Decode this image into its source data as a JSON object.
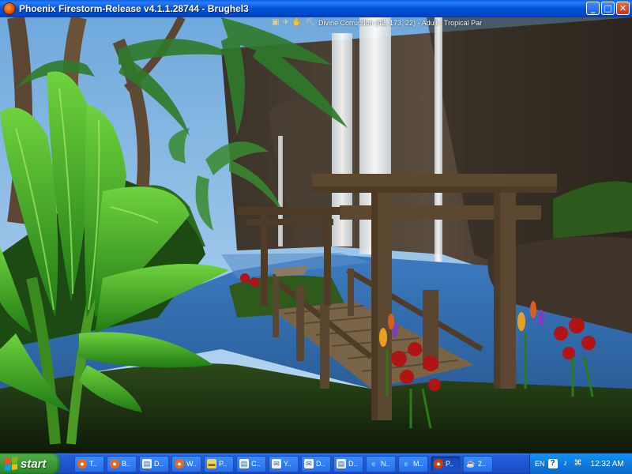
{
  "window": {
    "title": "Phoenix Firestorm-Release v4.1.1.28744 - Brughel3",
    "controls": {
      "minimize": "_",
      "maximize": "□",
      "close": "✕"
    }
  },
  "hud": {
    "icons": [
      "inventory-icon",
      "no-fly-icon",
      "no-push-icon",
      "no-build-icon"
    ],
    "location": "Divine Corruption (42, 173, 22) - Adult - Tropical Par"
  },
  "taskbar": {
    "start_label": "start",
    "tasks": [
      {
        "label": "T..",
        "icon": "firefox-icon"
      },
      {
        "label": "B..",
        "icon": "firefox-icon"
      },
      {
        "label": "D..",
        "icon": "document-icon"
      },
      {
        "label": "W..",
        "icon": "firefox-icon"
      },
      {
        "label": "P..",
        "icon": "folder-icon"
      },
      {
        "label": "C..",
        "icon": "document-icon"
      },
      {
        "label": "Y..",
        "icon": "mail-icon"
      },
      {
        "label": "D..",
        "icon": "mail-icon"
      },
      {
        "label": "D..",
        "icon": "document-icon"
      },
      {
        "label": "N..",
        "icon": "ie-icon"
      },
      {
        "label": "M..",
        "icon": "ie-icon"
      },
      {
        "label": "P..",
        "icon": "phoenix-icon",
        "active": true
      },
      {
        "label": "2..",
        "icon": "cup-icon"
      }
    ],
    "tray": {
      "language": "EN",
      "clock": "12:32 AM"
    }
  },
  "colors": {
    "titlebar": "#0050d8",
    "taskbar": "#245edb",
    "start_button": "#3c9a35",
    "sky": "#8cc4ee",
    "water": "#2f6aa8",
    "foliage": "#3aa82a",
    "wood": "#5a4630"
  }
}
